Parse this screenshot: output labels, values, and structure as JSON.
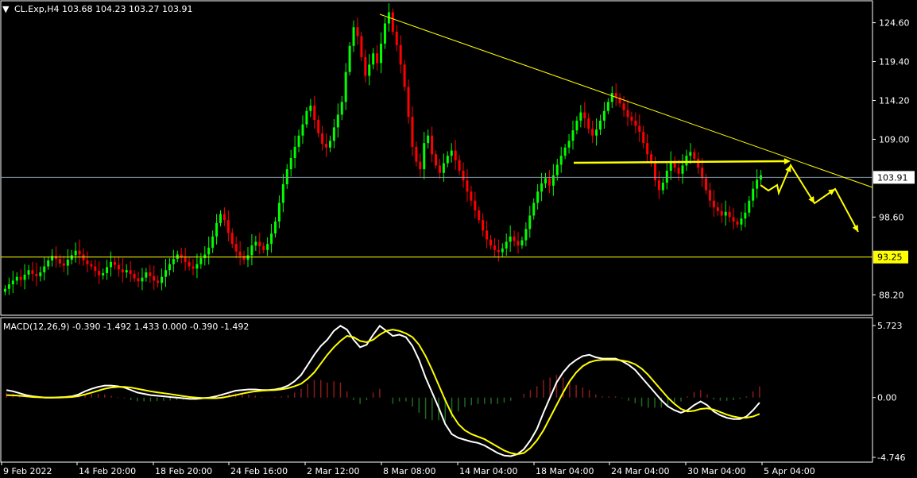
{
  "header": {
    "symbol_line": "CL.Exp,H4  103.68 104.23 103.27 103.91",
    "macd_line": "MACD(12,26,9) -0.390 -1.492 1.433 0.000 -0.390 -1.492"
  },
  "colors": {
    "background": "#000000",
    "bull": "#00ff00",
    "bear": "#ff0000",
    "trend": "#ffff00",
    "bid_line": "#8899aa",
    "macd": "#ffffff",
    "signal": "#ffff00",
    "hist_pos": "#8b1a1a",
    "hist_neg": "#1f6b1f",
    "frame": "#ffffff"
  },
  "chart_data": [
    {
      "type": "candlestick",
      "ylim": [
        86.0,
        127.0
      ],
      "yticks": [
        "124.60",
        "119.40",
        "114.20",
        "109.00",
        "98.60",
        "88.20"
      ],
      "current_price_label": "103.91",
      "support_label": "93.25",
      "support_level": 93.25,
      "current_price": 103.91,
      "xticks": [
        "9 Feb 2022",
        "14 Feb 20:00",
        "18 Feb 20:00",
        "24 Feb 16:00",
        "2 Mar 12:00",
        "8 Mar 08:00",
        "14 Mar 04:00",
        "18 Mar 04:00",
        "24 Mar 04:00",
        "30 Mar 04:00",
        "5 Apr 04:00"
      ],
      "series": [
        {
          "close": [
            89.0,
            89.6,
            90.1,
            90.6,
            90.2,
            90.9,
            91.5,
            91.0,
            90.7,
            91.2,
            92.0,
            92.8,
            93.4,
            93.0,
            92.4,
            92.1,
            92.9,
            93.5,
            94.1,
            93.6,
            92.8,
            92.3,
            92.0,
            91.4,
            90.8,
            91.1,
            91.9,
            92.6,
            92.2,
            91.6,
            91.2,
            91.5,
            91.0,
            90.4,
            90.0,
            90.5,
            91.2,
            90.7,
            90.1,
            89.8,
            90.6,
            91.5,
            92.3,
            93.0,
            93.6,
            93.2,
            92.6,
            92.0,
            91.7,
            92.3,
            93.1,
            93.6,
            94.5,
            96.0,
            97.8,
            99.0,
            98.2,
            96.5,
            95.0,
            94.0,
            93.4,
            92.9,
            93.5,
            94.8,
            95.3,
            94.7,
            94.2,
            95.0,
            96.4,
            98.0,
            100.5,
            103.0,
            105.0,
            106.5,
            108.0,
            109.5,
            111.0,
            112.8,
            113.5,
            111.6,
            109.8,
            108.4,
            107.9,
            108.8,
            110.6,
            112.3,
            114.0,
            118.0,
            121.5,
            124.0,
            122.8,
            120.0,
            117.5,
            119.0,
            120.5,
            119.2,
            121.8,
            124.5,
            126.0,
            123.4,
            121.6,
            119.0,
            116.0,
            112.0,
            108.0,
            106.0,
            105.0,
            108.5,
            109.5,
            107.0,
            105.5,
            104.5,
            105.8,
            106.8,
            107.5,
            106.2,
            104.8,
            103.5,
            102.0,
            100.8,
            99.5,
            98.2,
            96.8,
            95.6,
            94.8,
            94.2,
            93.9,
            94.4,
            95.3,
            96.0,
            95.4,
            94.8,
            95.5,
            97.0,
            98.8,
            100.5,
            102.0,
            103.1,
            103.8,
            102.8,
            104.2,
            105.6,
            106.8,
            107.9,
            108.8,
            110.2,
            111.5,
            112.6,
            111.8,
            110.4,
            109.5,
            110.3,
            111.5,
            112.8,
            114.0,
            115.2,
            114.6,
            113.8,
            112.9,
            112.0,
            111.5,
            110.8,
            110.0,
            108.5,
            107.0,
            105.8,
            103.5,
            102.2,
            103.2,
            104.8,
            106.0,
            105.2,
            104.4,
            105.5,
            106.8,
            107.3,
            106.4,
            105.2,
            103.8,
            102.2,
            100.8,
            99.9,
            99.4,
            98.8,
            99.3,
            98.6,
            98.0,
            97.6,
            98.4,
            99.2,
            100.8,
            102.4,
            103.6,
            104.2
          ]
        }
      ],
      "macd": {
        "ylim": [
          -4.746,
          5.723
        ],
        "yticks": [
          "5.723",
          "0.00",
          "-4.746"
        ],
        "macd": [
          0.6,
          0.5,
          0.35,
          0.2,
          0.1,
          0.05,
          0.0,
          0.0,
          0.02,
          0.05,
          0.1,
          0.25,
          0.5,
          0.7,
          0.85,
          0.95,
          0.95,
          0.9,
          0.8,
          0.6,
          0.4,
          0.3,
          0.2,
          0.15,
          0.1,
          0.05,
          0.0,
          -0.05,
          -0.1,
          -0.1,
          -0.05,
          0.0,
          0.1,
          0.25,
          0.4,
          0.55,
          0.6,
          0.65,
          0.65,
          0.6,
          0.6,
          0.65,
          0.75,
          0.95,
          1.3,
          1.8,
          2.6,
          3.4,
          4.1,
          4.6,
          5.3,
          5.7,
          5.4,
          4.6,
          4.0,
          4.2,
          5.0,
          5.7,
          5.3,
          4.9,
          5.0,
          4.8,
          4.1,
          3.0,
          1.6,
          0.4,
          -0.8,
          -2.1,
          -2.9,
          -3.2,
          -3.35,
          -3.5,
          -3.6,
          -3.8,
          -4.1,
          -4.4,
          -4.6,
          -4.65,
          -4.5,
          -4.1,
          -3.4,
          -2.5,
          -1.2,
          0.0,
          1.2,
          2.0,
          2.6,
          3.0,
          3.3,
          3.4,
          3.2,
          3.1,
          3.1,
          3.1,
          2.9,
          2.6,
          2.2,
          1.6,
          1.0,
          0.4,
          -0.2,
          -0.7,
          -1.0,
          -1.2,
          -1.0,
          -0.6,
          -0.3,
          -0.6,
          -1.1,
          -1.4,
          -1.6,
          -1.7,
          -1.7,
          -1.5,
          -1.0,
          -0.4
        ],
        "signal": [
          0.2,
          0.18,
          0.15,
          0.1,
          0.05,
          0.02,
          0.0,
          0.0,
          0.0,
          0.02,
          0.05,
          0.12,
          0.25,
          0.4,
          0.55,
          0.7,
          0.8,
          0.85,
          0.85,
          0.8,
          0.7,
          0.6,
          0.5,
          0.42,
          0.35,
          0.28,
          0.2,
          0.12,
          0.05,
          0.0,
          -0.03,
          -0.05,
          -0.05,
          0.0,
          0.1,
          0.2,
          0.32,
          0.42,
          0.5,
          0.55,
          0.58,
          0.6,
          0.65,
          0.75,
          0.9,
          1.1,
          1.5,
          2.0,
          2.7,
          3.4,
          4.0,
          4.5,
          4.9,
          4.8,
          4.5,
          4.4,
          4.6,
          5.0,
          5.3,
          5.4,
          5.3,
          5.1,
          4.8,
          4.2,
          3.3,
          2.2,
          1.0,
          -0.2,
          -1.3,
          -2.1,
          -2.6,
          -2.9,
          -3.1,
          -3.3,
          -3.6,
          -3.9,
          -4.2,
          -4.4,
          -4.5,
          -4.4,
          -4.0,
          -3.4,
          -2.6,
          -1.6,
          -0.6,
          0.4,
          1.3,
          2.0,
          2.5,
          2.8,
          2.95,
          3.0,
          3.0,
          3.0,
          2.95,
          2.85,
          2.65,
          2.3,
          1.8,
          1.2,
          0.6,
          0.0,
          -0.5,
          -0.9,
          -1.1,
          -1.05,
          -0.9,
          -0.85,
          -0.95,
          -1.15,
          -1.35,
          -1.5,
          -1.6,
          -1.6,
          -1.5,
          -1.3
        ]
      }
    }
  ]
}
